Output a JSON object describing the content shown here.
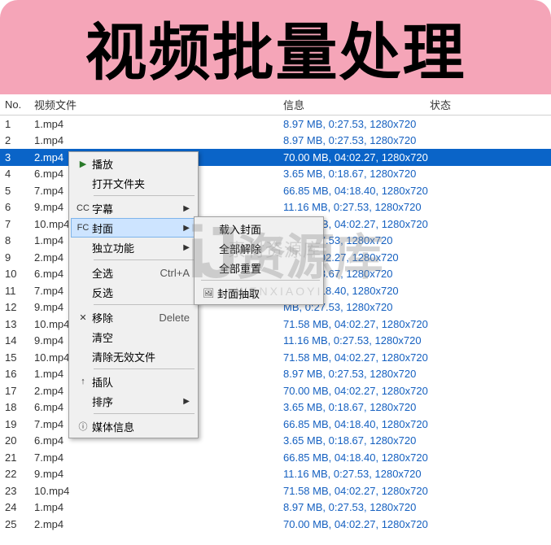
{
  "banner": {
    "title": "视频批量处理"
  },
  "headers": {
    "no": "No.",
    "file": "视频文件",
    "info": "信息",
    "status": "状态"
  },
  "rows": [
    {
      "no": "1",
      "file": "1.mp4",
      "info": "8.97 MB, 0:27.53, 1280x720"
    },
    {
      "no": "2",
      "file": "1.mp4",
      "info": "8.97 MB, 0:27.53, 1280x720"
    },
    {
      "no": "3",
      "file": "2.mp4",
      "info": "70.00 MB, 04:02.27, 1280x720",
      "selected": true
    },
    {
      "no": "4",
      "file": "6.mp4",
      "info": "3.65 MB, 0:18.67, 1280x720"
    },
    {
      "no": "5",
      "file": "7.mp4",
      "info": "66.85 MB, 04:18.40, 1280x720"
    },
    {
      "no": "6",
      "file": "9.mp4",
      "info": "11.16 MB, 0:27.53, 1280x720"
    },
    {
      "no": "7",
      "file": "10.mp4",
      "info": "71.58 MB, 04:02.27, 1280x720"
    },
    {
      "no": "8",
      "file": "1.mp4",
      "info": "MB, 0:27.53, 1280x720"
    },
    {
      "no": "9",
      "file": "2.mp4",
      "info": "MB, 04:02.27, 1280x720"
    },
    {
      "no": "10",
      "file": "6.mp4",
      "info": "MB, 0:18.67, 1280x720"
    },
    {
      "no": "11",
      "file": "7.mp4",
      "info": "MB, 04:18.40, 1280x720"
    },
    {
      "no": "12",
      "file": "9.mp4",
      "info": "MB, 0:27.53, 1280x720"
    },
    {
      "no": "13",
      "file": "10.mp4",
      "info": "71.58 MB, 04:02.27, 1280x720"
    },
    {
      "no": "14",
      "file": "9.mp4",
      "info": "11.16 MB, 0:27.53, 1280x720"
    },
    {
      "no": "15",
      "file": "10.mp4",
      "info": "71.58 MB, 04:02.27, 1280x720"
    },
    {
      "no": "16",
      "file": "1.mp4",
      "info": "8.97 MB, 0:27.53, 1280x720"
    },
    {
      "no": "17",
      "file": "2.mp4",
      "info": "70.00 MB, 04:02.27, 1280x720"
    },
    {
      "no": "18",
      "file": "6.mp4",
      "info": "3.65 MB, 0:18.67, 1280x720"
    },
    {
      "no": "19",
      "file": "7.mp4",
      "info": "66.85 MB, 04:18.40, 1280x720"
    },
    {
      "no": "20",
      "file": "6.mp4",
      "info": "3.65 MB, 0:18.67, 1280x720"
    },
    {
      "no": "21",
      "file": "7.mp4",
      "info": "66.85 MB, 04:18.40, 1280x720"
    },
    {
      "no": "22",
      "file": "9.mp4",
      "info": "11.16 MB, 0:27.53, 1280x720"
    },
    {
      "no": "23",
      "file": "10.mp4",
      "info": "71.58 MB, 04:02.27, 1280x720"
    },
    {
      "no": "24",
      "file": "1.mp4",
      "info": "8.97 MB, 0:27.53, 1280x720"
    },
    {
      "no": "25",
      "file": "2.mp4",
      "info": "70.00 MB, 04:02.27, 1280x720"
    }
  ],
  "menu": {
    "play": "播放",
    "open_folder": "打开文件夹",
    "subtitle": "字幕",
    "cover": "封面",
    "independent": "独立功能",
    "select_all": "全选",
    "select_all_key": "Ctrl+A",
    "invert": "反选",
    "remove": "移除",
    "remove_key": "Delete",
    "clear": "清空",
    "clear_invalid": "清除无效文件",
    "insert": "插队",
    "sort": "排序",
    "media_info": "媒体信息"
  },
  "submenu": {
    "load_cover": "载入封面",
    "remove_all": "全部解除",
    "reset_all": "全部重置",
    "extract_cover": "封面抽取"
  },
  "watermark": {
    "logo": "iJ",
    "brand": "资源库",
    "sub": "素材资源库",
    "url": "WENXIAOYI"
  }
}
